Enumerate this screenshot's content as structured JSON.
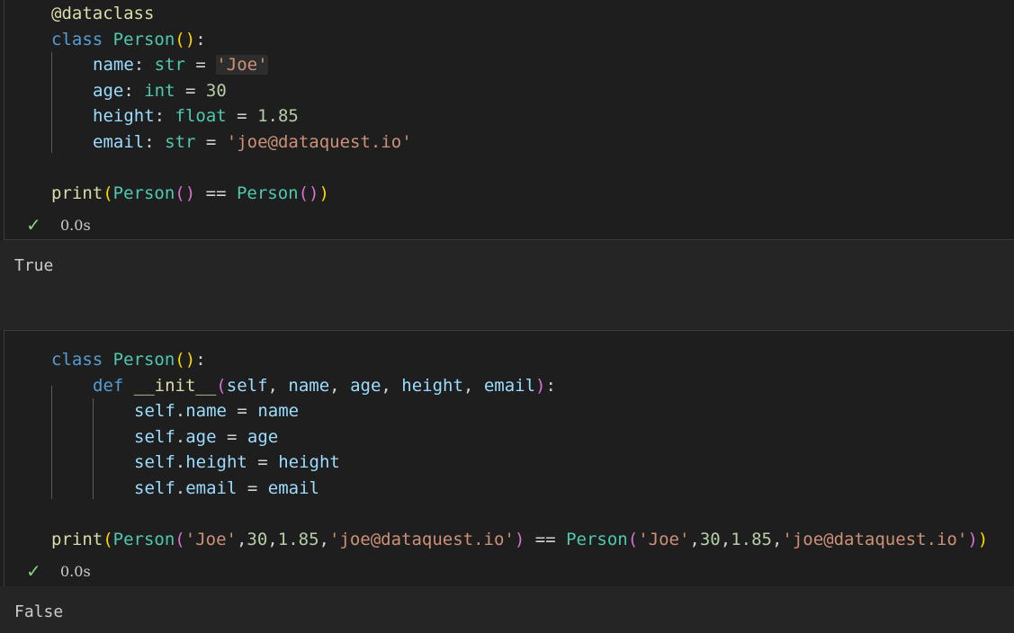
{
  "cell1": {
    "lines": [
      "@dataclass",
      "class Person():",
      "name: str = 'Joe'",
      "age: int = 30",
      "height: float = 1.85",
      "email: str = 'joe@dataquest.io'",
      "print(Person() == Person())"
    ],
    "status_time": "0.0s",
    "output": "True"
  },
  "cell2": {
    "lines": [
      "class Person():",
      "def __init__(self, name, age, height, email):",
      "self.name = name",
      "self.age = age",
      "self.height = height",
      "self.email = email",
      "print(Person('Joe',30,1.85,'joe@dataquest.io') == Person('Joe',30,1.85,'joe@dataquest.io'))"
    ],
    "status_time": "0.0s",
    "output": "False"
  },
  "colors": {
    "keyword": "#569cd6",
    "class": "#4ec9b0",
    "function": "#dcdcaa",
    "variable": "#9cdcfe",
    "string": "#ce9178",
    "number": "#b5cea8",
    "success": "#89d185"
  },
  "icons": {
    "status": "check-icon"
  }
}
